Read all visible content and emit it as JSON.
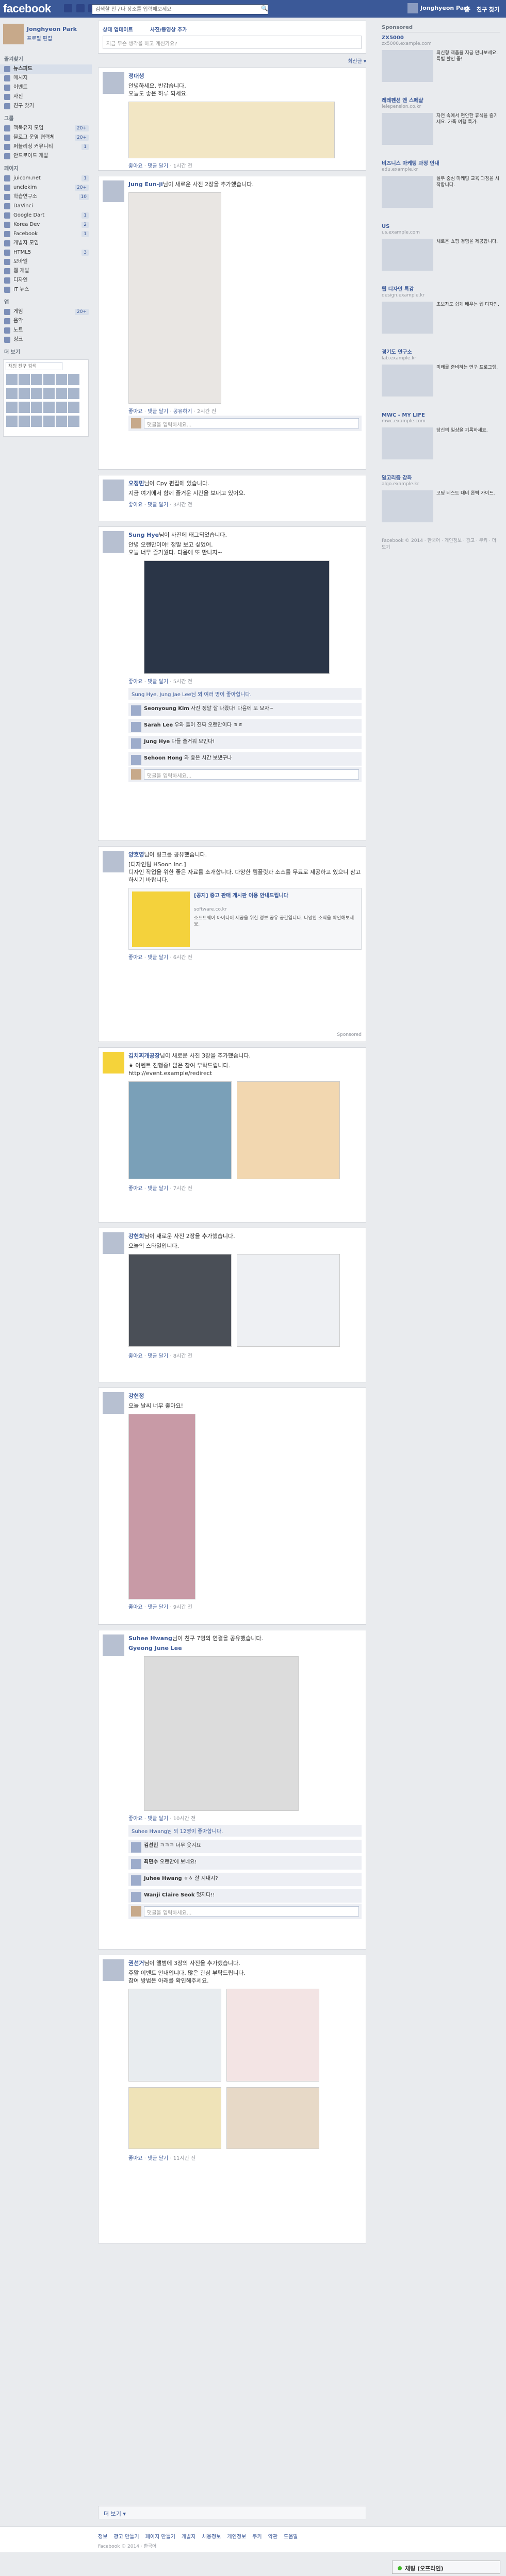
{
  "topbar": {
    "logo": "facebook",
    "search_placeholder": "검색할 친구나 장소를 입력해보세요",
    "user_name": "Jonghyeon Park",
    "home": "홈",
    "find_friends": "친구 찾기"
  },
  "left": {
    "profile_name": "Jonghyeon Park",
    "profile_edit": "프로필 편집",
    "favorites_title": "즐겨찾기",
    "favorites": [
      {
        "label": "뉴스피드",
        "count": ""
      },
      {
        "label": "메시지",
        "count": ""
      },
      {
        "label": "이벤트",
        "count": ""
      },
      {
        "label": "사진",
        "count": ""
      },
      {
        "label": "친구 찾기",
        "count": ""
      }
    ],
    "groups_title": "그룹",
    "groups": [
      {
        "label": "맥북유저 모임",
        "count": "20+"
      },
      {
        "label": "블로그 운영 협력체",
        "count": "20+"
      },
      {
        "label": "퍼블리싱 커뮤니티",
        "count": "1"
      },
      {
        "label": "안드로이드 개발",
        "count": ""
      }
    ],
    "pages_title": "페이지",
    "pages": [
      {
        "label": "juicom.net",
        "count": "1"
      },
      {
        "label": "unclekim",
        "count": "20+"
      },
      {
        "label": "학습연구소",
        "count": "10"
      },
      {
        "label": "DaVinci",
        "count": ""
      },
      {
        "label": "Google Dart",
        "count": "1"
      },
      {
        "label": "Korea Dev",
        "count": "2"
      },
      {
        "label": "Facebook",
        "count": "1"
      },
      {
        "label": "개발자 모임",
        "count": ""
      },
      {
        "label": "HTML5",
        "count": "3"
      },
      {
        "label": "모바일",
        "count": ""
      },
      {
        "label": "웹 개발",
        "count": ""
      },
      {
        "label": "디자인",
        "count": ""
      },
      {
        "label": "IT 뉴스",
        "count": ""
      }
    ],
    "apps_title": "앱",
    "apps": [
      {
        "label": "게임",
        "count": "20+"
      },
      {
        "label": "음악",
        "count": ""
      },
      {
        "label": "노트",
        "count": ""
      },
      {
        "label": "링크",
        "count": ""
      }
    ],
    "more_title": "더 보기",
    "chat_search_placeholder": "채팅 친구 검색"
  },
  "composer": {
    "status_tab": "상태 업데이트",
    "photo_tab": "사진/동영상 추가",
    "placeholder": "지금 무슨 생각을 하고 계신가요?",
    "sort": "최신글 ▾"
  },
  "stories": [
    {
      "author": "정대생",
      "action": "",
      "text": "안녕하세요. 반갑습니다.\n오늘도 좋은 하루 되세요.",
      "time": "1시간 전",
      "likes": "",
      "comment_placeholder": "댓글을 입력하세요..."
    },
    {
      "author": "Jung Eun-ji",
      "action": "님이 새로운 사진 2장을 추가했습니다.",
      "text": "",
      "time": "2시간 전",
      "likes": "",
      "comment_placeholder": "댓글을 입력하세요..."
    },
    {
      "author": "오정민",
      "action": "님이 Cpy 편집에 있습니다.",
      "text": "지금 여기에서 함께 즐거운 시간을 보내고 있어요.",
      "time": "3시간 전",
      "likes": "",
      "comment_placeholder": "댓글을 입력하세요..."
    },
    {
      "author": "Sung Hye",
      "action": "님이 사진에 태그되었습니다.",
      "text": "안녕 오랜만이야! 정말 보고 싶었어.\n오늘 너무 즐거웠다. 다음에 또 만나자~",
      "time": "5시간 전",
      "likes": "Sung Hye, Jung Jae Lee님 외 여러 명이 좋아합니다.",
      "comments": [
        {
          "name": "Seonyoung Kim",
          "text": "사진 정말 잘 나왔다! 다음에 또 보자~"
        },
        {
          "name": "Sarah Lee",
          "text": "우와 둘이 진짜 오랜만이다 ㅎㅎ"
        },
        {
          "name": "Jung Hye",
          "text": "다들 즐거워 보인다!"
        },
        {
          "name": "Sehoon Hong",
          "text": "와 좋은 시간 보냈구나"
        }
      ],
      "comment_placeholder": "댓글을 입력하세요..."
    },
    {
      "author": "양호영",
      "action": "님이 링크를 공유했습니다.",
      "text": "[디자인팀 HSoon Inc.]\n디자인 작업을 위한 좋은 자료를 소개합니다. 다양한 템플릿과 소스를 무료로 제공하고 있으니 참고하시기 바랍니다.",
      "link_title": "[공지] 중고 판매 게시판 이용 안내드립니다",
      "link_url": "software.co.kr",
      "link_desc": "소프트웨어 아이디어 제공을 위한 정보 공유 공간입니다. 다양한 소식을 확인해보세요.",
      "time": "6시간 전",
      "sponsored": "Sponsored",
      "comment_placeholder": "댓글을 입력하세요..."
    },
    {
      "author": "김치찌개공장",
      "action": "님이 새로운 사진 3장을 추가했습니다.",
      "text": "★ 이벤트 진행중! 많은 참여 부탁드립니다.\nhttp://event.example/redirect",
      "time": "7시간 전",
      "likes": "",
      "comment_placeholder": "댓글을 입력하세요..."
    },
    {
      "author": "강현희",
      "action": "님이 새로운 사진 2장을 추가했습니다.",
      "text": "오늘의 스타일입니다.",
      "time": "8시간 전",
      "likes": "",
      "comment_placeholder": "댓글을 입력하세요..."
    },
    {
      "author": "강현정",
      "action": "",
      "text": "오늘 날씨 너무 좋아요!",
      "time": "9시간 전",
      "likes": "",
      "comment_placeholder": "댓글을 입력하세요..."
    },
    {
      "author": "Suhee Hwang",
      "action": "님이 친구 7명의 연결을 공유했습니다.",
      "text": "Gyeong June Lee",
      "time": "10시간 전",
      "likes": "Suhee Hwang님 외 12명이 좋아합니다.",
      "comments": [
        {
          "name": "김선민",
          "text": "ㅋㅋㅋ 너무 웃겨요"
        },
        {
          "name": "최민수",
          "text": "오랜만에 보네요!"
        },
        {
          "name": "Juhee Hwang",
          "text": "ㅎㅎ 잘 지내지?"
        },
        {
          "name": "Wanji Claire Seok",
          "text": "멋지다!!"
        }
      ],
      "comment_placeholder": "댓글을 입력하세요..."
    },
    {
      "author": "권선거",
      "action": "님이 앨범에 3장의 사진을 추가했습니다.",
      "text": "주말 이벤트 안내입니다. 많은 관심 부탁드립니다.\n참여 방법은 아래를 확인해주세요.",
      "time": "11시간 전",
      "likes": "",
      "comment_placeholder": "댓글을 입력하세요..."
    }
  ],
  "feed_more": "더 보기 ▾",
  "right": {
    "sponsored_title": "Sponsored",
    "ads": [
      {
        "title": "ZX5000",
        "url": "zx5000.example.com",
        "desc": "최신형 제품을 지금 만나보세요. 특별 할인 중!"
      },
      {
        "title": "레레펜션 앤 스페샬",
        "url": "lelepension.co.kr",
        "desc": "자연 속에서 편안한 휴식을 즐기세요. 가족 여행 특가."
      },
      {
        "title": "비즈니스 마케팅 과정 안내",
        "url": "edu.example.kr",
        "desc": "실무 중심 마케팅 교육 과정을 시작합니다."
      },
      {
        "title": "US",
        "url": "us.example.com",
        "desc": "새로운 쇼핑 경험을 제공합니다."
      },
      {
        "title": "웹 디자인 특강",
        "url": "design.example.kr",
        "desc": "초보자도 쉽게 배우는 웹 디자인."
      },
      {
        "title": "경기도 연구소",
        "url": "lab.example.kr",
        "desc": "미래를 준비하는 연구 프로그램."
      },
      {
        "title": "MWC - MY LIFE",
        "url": "mwc.example.com",
        "desc": "당신의 일상을 기록하세요."
      },
      {
        "title": "알고리즘 강좌",
        "url": "algo.example.kr",
        "desc": "코딩 테스트 대비 완벽 가이드."
      }
    ],
    "footer": "Facebook © 2014 · 한국어 · 개인정보 · 광고 · 쿠키 · 더 보기"
  },
  "bottom": {
    "links": [
      "정보",
      "광고 만들기",
      "페이지 만들기",
      "개발자",
      "채용정보",
      "개인정보",
      "쿠키",
      "약관",
      "도움말"
    ],
    "copyright": "Facebook © 2014 · 한국어"
  },
  "chat": {
    "label": "채팅 (오프라인)"
  }
}
